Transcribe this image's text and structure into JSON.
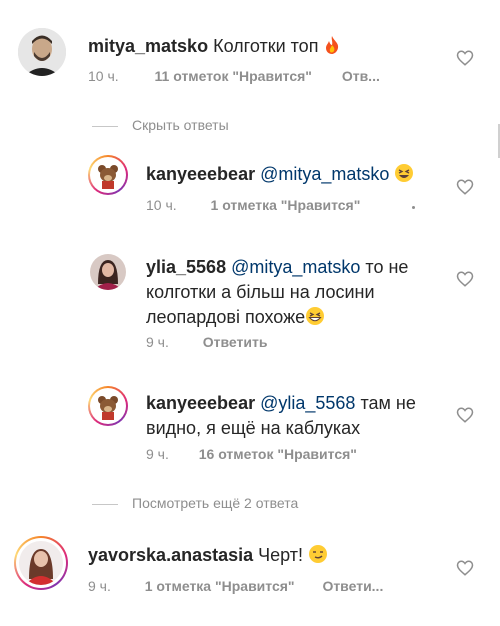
{
  "comments": [
    {
      "username": "mitya_matsko",
      "text": "Колготки топ",
      "time": "10 ч.",
      "likes": "11 отметок \"Нравится\"",
      "reply": "Отв..."
    },
    {
      "username": "kanyeeebear",
      "mention": "@mitya_matsko",
      "time": "10 ч.",
      "likes": "1 отметка \"Нравится\""
    },
    {
      "username": "ylia_5568",
      "mention": "@mitya_matsko",
      "text_line1": "то не",
      "text_line2": "колготки а більш на лосини",
      "text_line3": "леопардові похоже",
      "time": "9 ч.",
      "reply": "Ответить"
    },
    {
      "username": "kanyeeebear",
      "mention": "@ylia_5568",
      "text_line1": "там не",
      "text_line2": "видно, я ещё на каблуках",
      "time": "9 ч.",
      "likes": "16 отметок \"Нравится\""
    },
    {
      "username": "yavorska.anastasia",
      "text": "Черт!",
      "time": "9 ч.",
      "likes": "1 отметка \"Нравится\"",
      "reply": "Ответи..."
    }
  ],
  "hide_replies": "Скрыть ответы",
  "view_more": "Посмотреть ещё 2 ответа",
  "icons": {
    "like": "heart-outline-icon",
    "fire": "fire-emoji",
    "laugh": "laughing-emoji",
    "grin": "grinning-squint-emoji",
    "smirk": "smirk-emoji"
  },
  "colors": {
    "text": "#262626",
    "meta": "#8e8e8e",
    "mention": "#00376b"
  }
}
